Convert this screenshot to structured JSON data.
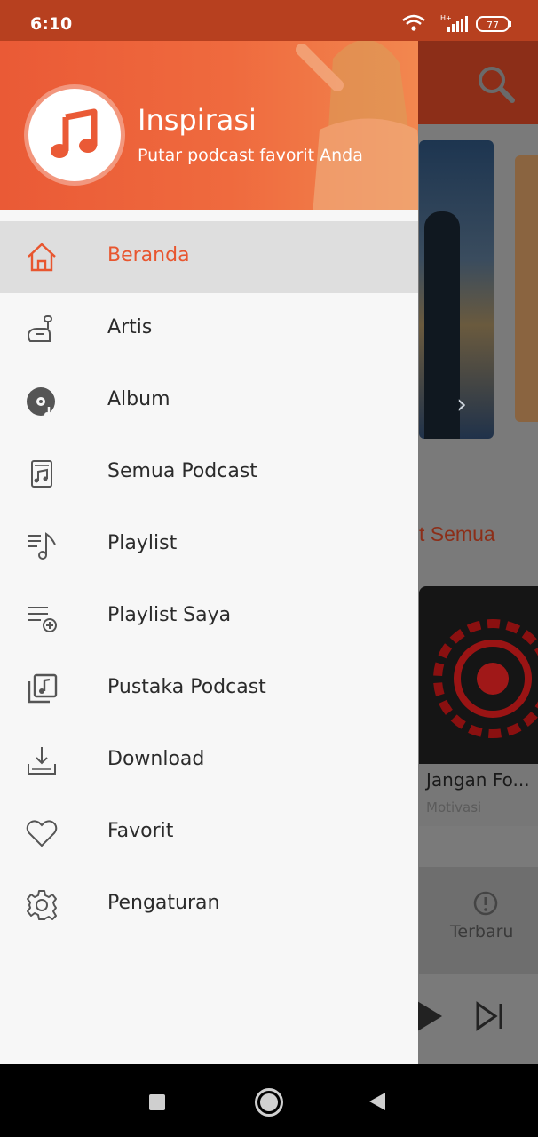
{
  "status_bar": {
    "time": "6:10",
    "battery": "77",
    "network": "H+"
  },
  "drawer": {
    "header": {
      "title": "Inspirasi",
      "subtitle": "Putar podcast favorit Anda",
      "logo_icon": "music-note-icon"
    },
    "items": [
      {
        "label": "Beranda",
        "icon": "home-icon",
        "active": true
      },
      {
        "label": "Artis",
        "icon": "artist-icon",
        "active": false
      },
      {
        "label": "Album",
        "icon": "album-disc-icon",
        "active": false
      },
      {
        "label": "Semua Podcast",
        "icon": "podcast-file-icon",
        "active": false
      },
      {
        "label": "Playlist",
        "icon": "playlist-icon",
        "active": false
      },
      {
        "label": "Playlist Saya",
        "icon": "playlist-add-icon",
        "active": false
      },
      {
        "label": "Pustaka Podcast",
        "icon": "library-icon",
        "active": false
      },
      {
        "label": "Download",
        "icon": "download-icon",
        "active": false
      },
      {
        "label": "Favorit",
        "icon": "heart-icon",
        "active": false
      },
      {
        "label": "Pengaturan",
        "icon": "gear-icon",
        "active": false
      }
    ]
  },
  "background": {
    "section_link": "t Semua",
    "card_title": "Jangan Fo...",
    "card_category": "Motivasi",
    "tab_label": "Terbaru"
  },
  "colors": {
    "accent": "#e8562f",
    "status_bar": "#b7401f",
    "active_item_bg": "#dedede",
    "drawer_bg": "#f7f7f7"
  }
}
